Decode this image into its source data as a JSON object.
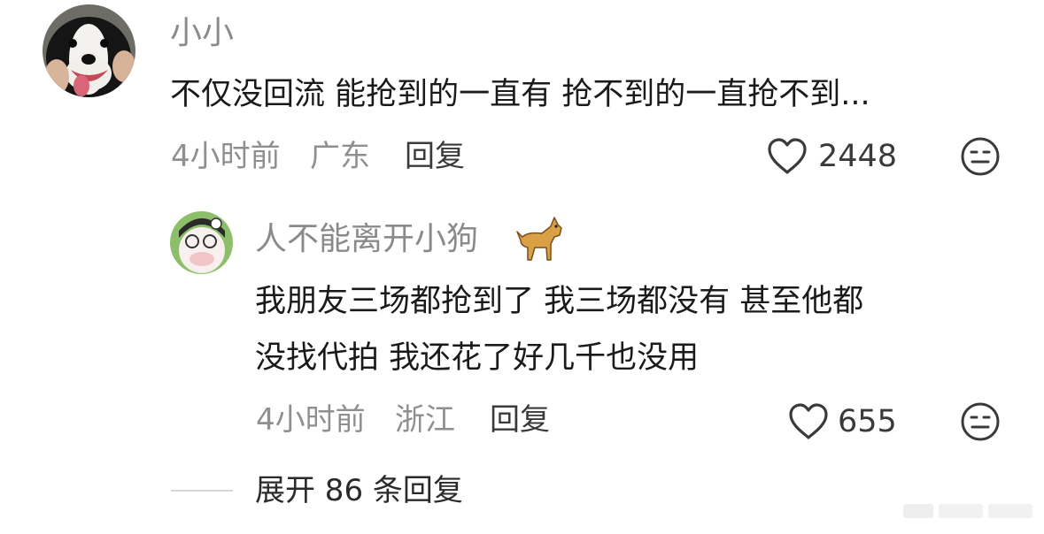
{
  "comment": {
    "author": "小小",
    "text": "不仅没回流 能抢到的一直有 抢不到的一直抢不到...",
    "time": "4小时前",
    "location": "广东",
    "reply_label": "回复",
    "likes": "2448"
  },
  "reply": {
    "author": "人不能离开小狗",
    "text_line1": "我朋友三场都抢到了 我三场都没有 甚至他都",
    "text_line2": "没找代拍 我还花了好几千也没用",
    "time": "4小时前",
    "location": "浙江",
    "reply_label": "回复",
    "likes": "655"
  },
  "expand_label": "展开 86 条回复",
  "icons": {
    "like": "heart-outline-icon",
    "dislike": "meh-face-icon",
    "author_badge": "dog-emoji-icon"
  },
  "colors": {
    "text_primary": "#1a1a1a",
    "text_secondary": "#8f8f8f"
  }
}
